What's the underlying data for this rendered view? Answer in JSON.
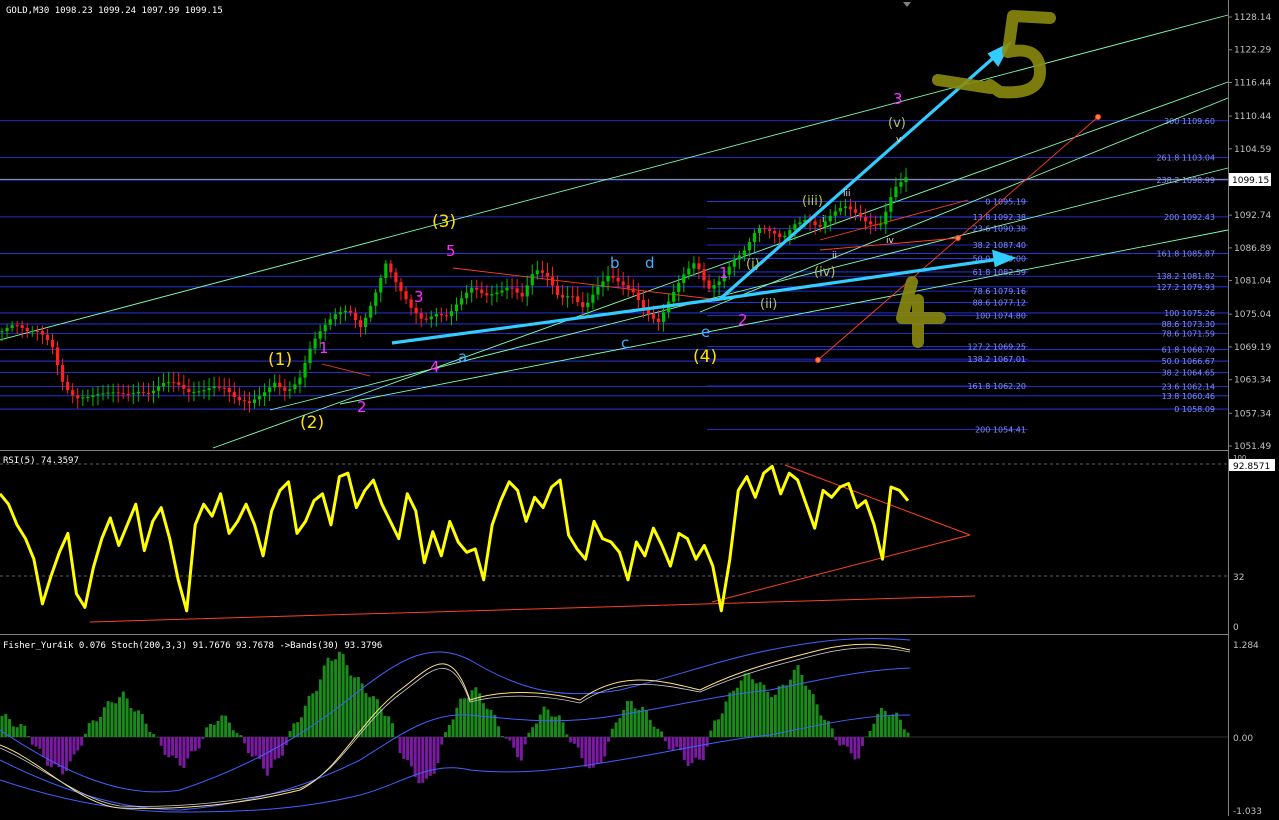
{
  "colors": {
    "bg": "#000000",
    "grid_blue": "#3b4fff",
    "axis": "#c0c0c0",
    "bull": "#00c000",
    "bear": "#ff2020",
    "rsi": "#ffff00",
    "trend_red": "#ff4020",
    "fib_line": "#2a3cff",
    "fan_green": "#7fffb0",
    "cyan_arrow": "#33ccff",
    "wave_yellow": "#ffe000",
    "wave_magenta": "#ff30ff",
    "wave_cyan": "#40b0ff",
    "wave_olive": "#b8c060",
    "fisher_up": "#1a8a1a",
    "fisher_dn": "#7a1aa0",
    "band_blue": "#4060ff",
    "stoch_yellow": "#ffe080",
    "hand_olive": "#8a8a10"
  },
  "header": {
    "main": "GOLD,M30  1098.23 1099.24 1097.99 1099.15",
    "rsi": "RSI(5) 74.3597",
    "fisher": "Fisher_Yur4ik 0.076   Stoch(200,3,3) 91.7676 93.7678   ->Bands(30) 93.3796"
  },
  "price_axis": {
    "labels": [
      "1128.14",
      "1122.29",
      "1116.44",
      "1110.44",
      "1104.59",
      "1098.74",
      "1092.74",
      "1086.89",
      "1081.04",
      "1075.04",
      "1069.19",
      "1063.34",
      "1057.34",
      "1051.49"
    ],
    "current": "1099.15"
  },
  "rsi_axis": {
    "labels": [
      "100",
      "92.8571",
      "32",
      "0"
    ]
  },
  "fisher_axis": {
    "labels": [
      "1.284",
      "0.00",
      "-1.033"
    ]
  },
  "fib_levels": {
    "right_set": [
      "300 1109.60",
      "261.8 1103.04",
      "238.2 1098.99",
      "200 1092.43",
      "161.8 1085.87",
      "138.2 1081.82",
      "127.2 1079.93",
      "100 1075.26",
      "88.6 1073.30",
      "78.6 1071.59",
      "61.8 1068.70",
      "50.0 1066.67",
      "38.2 1064.65",
      "23.6 1062.14",
      "13.8 1060.46",
      "0 1058.09"
    ],
    "mid_set": [
      "0 1095.19",
      "13.8 1092.38",
      "23.6 1090.38",
      "38.2 1087.40",
      "50.0 1085.00",
      "61.8 1082.59",
      "78.6 1079.16",
      "88.6 1077.12",
      "100 1074.80",
      "127.2 1069.25",
      "138.2 1067.01",
      "161.8 1062.20",
      "200 1054.41"
    ]
  },
  "wave_labels": {
    "yellow": [
      "(1)",
      "(2)",
      "(3)",
      "(4)"
    ],
    "magenta": [
      "1",
      "2",
      "3",
      "4",
      "5",
      "1",
      "2",
      "3"
    ],
    "cyan": [
      "a",
      "b",
      "c",
      "d",
      "e"
    ],
    "olive": [
      "(i)",
      "(ii)",
      "(iii)",
      "(iv)",
      "(v)"
    ],
    "roman": [
      "i",
      "ii",
      "iii",
      "iv",
      "v"
    ],
    "hand": [
      "5",
      "4"
    ]
  },
  "chart_data": {
    "type": "candlestick",
    "symbol": "GOLD",
    "timeframe": "M30",
    "ohlc_last": {
      "open": 1098.23,
      "high": 1099.24,
      "low": 1097.99,
      "close": 1099.15
    },
    "ylim": [
      1050.5,
      1130
    ],
    "close_path": [
      1072.0,
      1072.5,
      1071.2,
      1072.0,
      1070.5,
      1063.0,
      1060.0,
      1059.5,
      1060.0,
      1061.0,
      1061.5,
      1062.0,
      1061.0,
      1062.0,
      1062.0,
      1061.0,
      1062.0,
      1063.0,
      1062.0,
      1059.0,
      1058.3,
      1060.5,
      1063.5,
      1062.0,
      1063.5,
      1069.0,
      1072.0,
      1075.0,
      1076.5,
      1073.5,
      1078.0,
      1083.5,
      1079.0,
      1076.0,
      1074.5,
      1076.0,
      1075.0,
      1077.0,
      1079.0,
      1078.0,
      1079.5,
      1081.0,
      1078.5,
      1082.5,
      1081.0,
      1077.5,
      1079.0,
      1077.0,
      1080.0,
      1081.5,
      1079.5,
      1078.5,
      1076.0,
      1074.5,
      1078.5,
      1081.5,
      1083.5,
      1079.0,
      1081.5,
      1085.5,
      1087.0,
      1090.0,
      1089.0,
      1088.0,
      1091.5,
      1093.0,
      1091.0,
      1092.5,
      1093.5,
      1092.5,
      1091.5,
      1092.0,
      1098.0,
      1099.15
    ],
    "rsi": {
      "name": "RSI(5)",
      "value": 74.3597,
      "levels": [
        92.8571,
        32
      ],
      "values": [
        78,
        72,
        60,
        52,
        40,
        14,
        30,
        44,
        55,
        20,
        12,
        35,
        52,
        64,
        48,
        60,
        72,
        45,
        62,
        70,
        52,
        28,
        10,
        60,
        72,
        65,
        78,
        55,
        62,
        72,
        60,
        42,
        68,
        80,
        85,
        55,
        62,
        74,
        78,
        60,
        88,
        90,
        70,
        80,
        86,
        72,
        62,
        52,
        78,
        68,
        38,
        56,
        42,
        62,
        50,
        44,
        46,
        28,
        60,
        74,
        85,
        80,
        62,
        76,
        70,
        82,
        86,
        54,
        46,
        40,
        62,
        52,
        50,
        44,
        28,
        50,
        42,
        58,
        48,
        36,
        55,
        52,
        40,
        48,
        36,
        10,
        40,
        80,
        88,
        76,
        90,
        94,
        78,
        90,
        86,
        72,
        58,
        80,
        76,
        82,
        84,
        70,
        74,
        60,
        40,
        82,
        80,
        74
      ]
    },
    "fisher": {
      "name": "Fisher_Yur4ik",
      "value": 0.076,
      "values": [
        0.3,
        0.2,
        0.1,
        -0.2,
        -0.4,
        -0.5,
        -0.3,
        0.1,
        0.3,
        0.5,
        0.6,
        0.4,
        0.2,
        -0.1,
        -0.3,
        -0.4,
        -0.2,
        0.1,
        0.3,
        0.2,
        -0.1,
        -0.3,
        -0.5,
        -0.3,
        0.1,
        0.4,
        0.7,
        1.1,
        1.2,
        0.9,
        0.7,
        0.5,
        0.3,
        -0.2,
        -0.5,
        -0.7,
        -0.4,
        0.2,
        0.5,
        0.7,
        0.5,
        0.2,
        -0.1,
        -0.3,
        0.2,
        0.4,
        0.3,
        0.0,
        -0.3,
        -0.5,
        -0.2,
        0.3,
        0.5,
        0.4,
        0.2,
        -0.1,
        -0.2,
        -0.4,
        -0.3,
        0.2,
        0.5,
        0.8,
        0.9,
        0.7,
        0.6,
        0.8,
        1.0,
        0.6,
        0.3,
        0.0,
        -0.2,
        -0.3,
        0.2,
        0.4,
        0.3,
        0.1
      ]
    },
    "stoch": {
      "name": "Stoch(200,3,3)",
      "main": 91.7676,
      "signal": 93.7678
    },
    "bands": {
      "name": "Bands(30)",
      "value": 93.3796
    }
  }
}
